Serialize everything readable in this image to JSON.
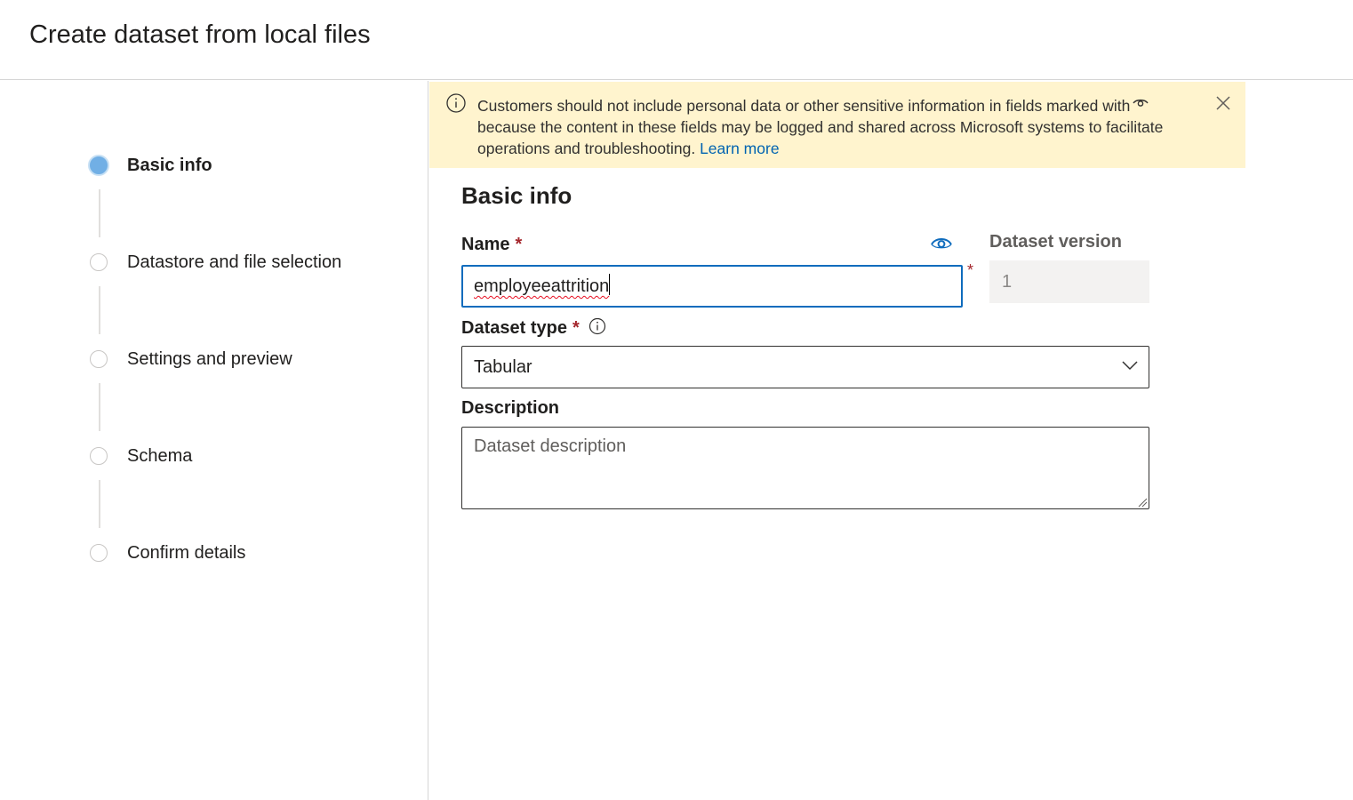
{
  "header": {
    "title": "Create dataset from local files"
  },
  "steps": [
    {
      "label": "Basic info",
      "active": true
    },
    {
      "label": "Datastore and file selection",
      "active": false
    },
    {
      "label": "Settings and preview",
      "active": false
    },
    {
      "label": "Schema",
      "active": false
    },
    {
      "label": "Confirm details",
      "active": false
    }
  ],
  "banner": {
    "text_part1": "Customers should not include personal data or other sensitive information in fields marked with",
    "text_part2": "because the content in these fields may be logged and shared across Microsoft systems to facilitate operations and troubleshooting.",
    "link": "Learn more",
    "icons": [
      "info-icon",
      "eye-icon",
      "close-icon"
    ]
  },
  "form": {
    "section_title": "Basic info",
    "name": {
      "label": "Name",
      "required_mark": "*",
      "value": "employeeattrition",
      "icon": "eye-icon"
    },
    "version": {
      "label": "Dataset version",
      "value": "1"
    },
    "dataset_type": {
      "label": "Dataset type",
      "required_mark": "*",
      "value": "Tabular",
      "icon": "chevron-down-icon"
    },
    "description": {
      "label": "Description",
      "placeholder": "Dataset description"
    }
  },
  "colors": {
    "banner_bg": "#fff4ce",
    "focus_border": "#0f6cbd",
    "required": "#a4262c",
    "active_step": "#71afe5",
    "link": "#0063b1"
  }
}
